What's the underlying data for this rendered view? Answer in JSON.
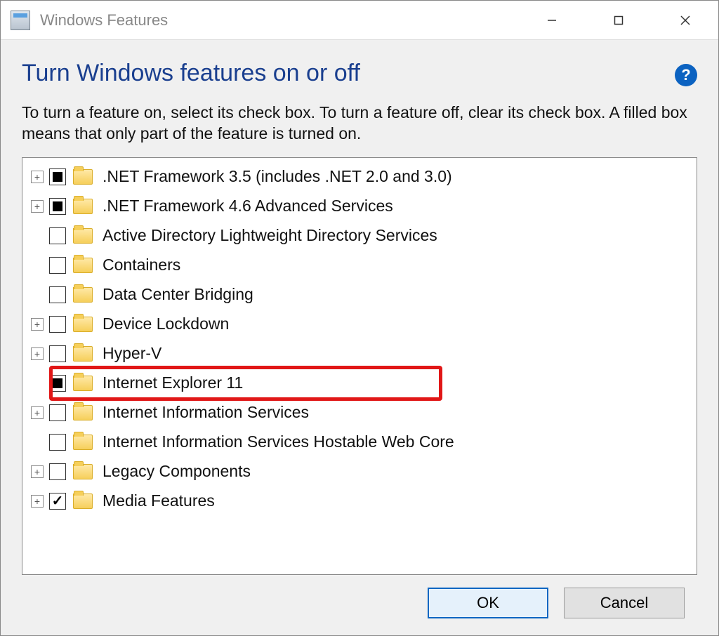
{
  "window": {
    "title": "Windows Features"
  },
  "header": {
    "heading": "Turn Windows features on or off",
    "description": "To turn a feature on, select its check box. To turn a feature off, clear its check box. A filled box means that only part of the feature is turned on.",
    "help_tooltip": "?"
  },
  "tree": {
    "items": [
      {
        "label": ".NET Framework 3.5 (includes .NET 2.0 and 3.0)",
        "expandable": true,
        "state": "filled"
      },
      {
        "label": ".NET Framework 4.6 Advanced Services",
        "expandable": true,
        "state": "filled"
      },
      {
        "label": "Active Directory Lightweight Directory Services",
        "expandable": false,
        "state": "empty"
      },
      {
        "label": "Containers",
        "expandable": false,
        "state": "empty"
      },
      {
        "label": "Data Center Bridging",
        "expandable": false,
        "state": "empty"
      },
      {
        "label": "Device Lockdown",
        "expandable": true,
        "state": "empty"
      },
      {
        "label": "Hyper-V",
        "expandable": true,
        "state": "empty"
      },
      {
        "label": "Internet Explorer 11",
        "expandable": false,
        "state": "filled",
        "highlighted": true
      },
      {
        "label": "Internet Information Services",
        "expandable": true,
        "state": "empty"
      },
      {
        "label": "Internet Information Services Hostable Web Core",
        "expandable": false,
        "state": "empty"
      },
      {
        "label": "Legacy Components",
        "expandable": true,
        "state": "empty"
      },
      {
        "label": "Media Features",
        "expandable": true,
        "state": "checked"
      }
    ]
  },
  "buttons": {
    "ok": "OK",
    "cancel": "Cancel"
  }
}
